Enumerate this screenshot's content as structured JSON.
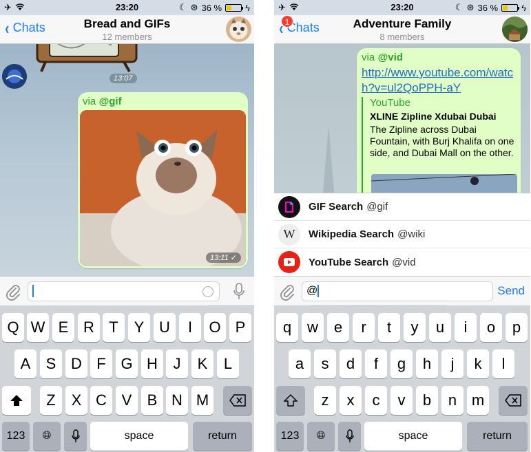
{
  "left": {
    "status": {
      "time": "23:20",
      "battery": "36 %"
    },
    "nav": {
      "back": "Chats",
      "title": "Bread and GIFs",
      "subtitle": "12 members"
    },
    "messages": {
      "sticker_time": "13:07",
      "gif_via": "via",
      "gif_bot": "@gif",
      "gif_time": "13:11"
    },
    "input": {
      "value": ""
    }
  },
  "right": {
    "status": {
      "time": "23:20",
      "battery": "36 %"
    },
    "nav": {
      "back": "Chats",
      "badge": "1",
      "title": "Adventure Family",
      "subtitle": "8 members"
    },
    "message": {
      "via": "via",
      "bot": "@vid",
      "link": "http://www.youtube.com/watch?v=ul2QoPPH-aY",
      "preview_site": "YouTube",
      "preview_title": "XLINE Zipline Xdubai Dubai",
      "preview_desc": "The Zipline across Dubai Fountain, with Burj Khalifa on one side, and Dubai Mall on the other."
    },
    "suggestions": [
      {
        "name": "GIF Search",
        "username": "@gif",
        "icon": "gif-icon"
      },
      {
        "name": "Wikipedia Search",
        "username": "@wiki",
        "icon": "wikipedia-icon"
      },
      {
        "name": "YouTube Search",
        "username": "@vid",
        "icon": "youtube-icon"
      }
    ],
    "input": {
      "value": "@",
      "send": "Send"
    }
  },
  "keyboard_left": {
    "row1": [
      "Q",
      "W",
      "E",
      "R",
      "T",
      "Y",
      "U",
      "I",
      "O",
      "P"
    ],
    "row2": [
      "A",
      "S",
      "D",
      "F",
      "G",
      "H",
      "J",
      "K",
      "L"
    ],
    "row3": [
      "Z",
      "X",
      "C",
      "V",
      "B",
      "N",
      "M"
    ],
    "numbers": "123",
    "space": "space",
    "return": "return"
  },
  "keyboard_right": {
    "row1": [
      "q",
      "w",
      "e",
      "r",
      "t",
      "y",
      "u",
      "i",
      "o",
      "p"
    ],
    "row2": [
      "a",
      "s",
      "d",
      "f",
      "g",
      "h",
      "j",
      "k",
      "l"
    ],
    "row3": [
      "z",
      "x",
      "c",
      "v",
      "b",
      "n",
      "m"
    ],
    "numbers": "123",
    "space": "space",
    "return": "return"
  },
  "colors": {
    "accent": "#1e7cf0",
    "bubble": "#e1fec6",
    "via": "#2aa52a",
    "youtube": "#e62117"
  }
}
